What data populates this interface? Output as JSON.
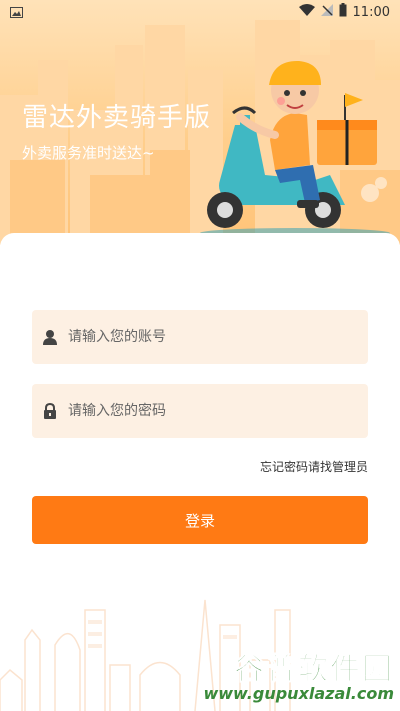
{
  "statusbar": {
    "time": "11:00"
  },
  "hero": {
    "title": "雷达外卖骑手版",
    "subtitle": "外卖服务准时送达~"
  },
  "form": {
    "account_placeholder": "请输入您的账号",
    "password_placeholder": "请输入您的密码",
    "forgot_label": "忘记密码请找管理员",
    "login_label": "登录"
  },
  "watermark": {
    "brand": "谷普软件园",
    "url": "www.gupuxlazal.com"
  },
  "colors": {
    "accent": "#ff7a14",
    "input_bg": "#fdf0e3",
    "hero_bg": "#ffcf8d"
  }
}
